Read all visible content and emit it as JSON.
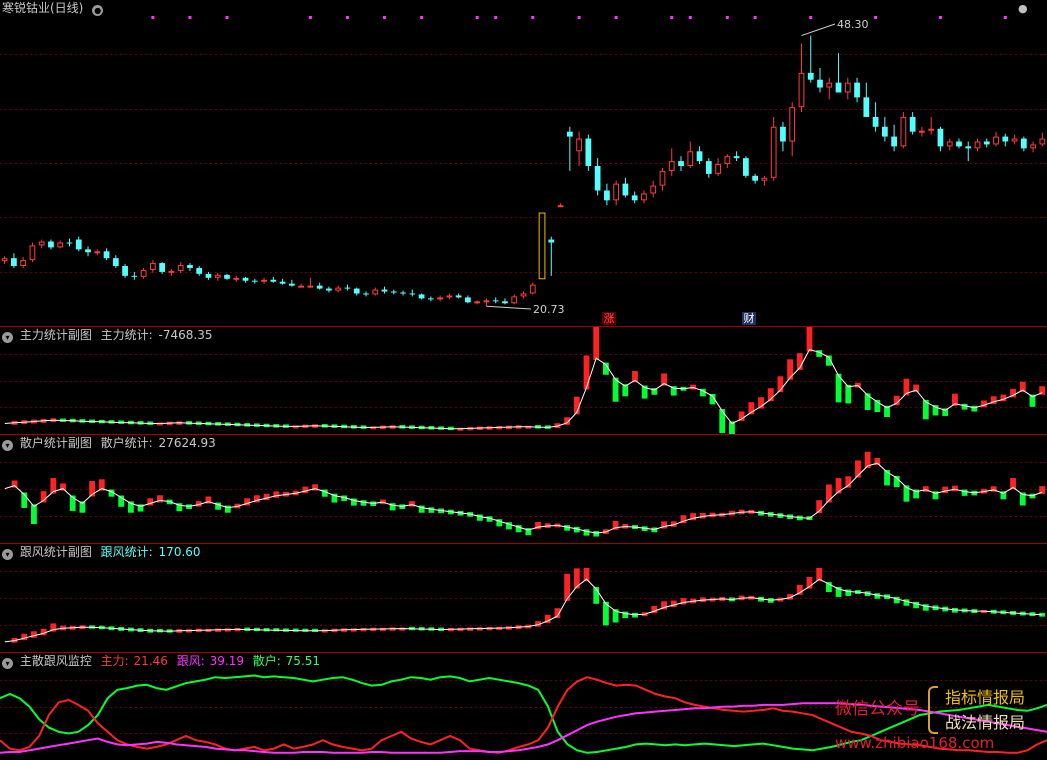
{
  "colors": {
    "up": "#ff3b3b",
    "down": "#54ffff",
    "grid": "#6a0000",
    "sep": "#a00000",
    "green": "#00ff33",
    "white": "#ffffff",
    "magenta": "#ff33ff",
    "red": "#ff2222",
    "mainforce_label": "#ff3b3b",
    "followwind_label": "#ff33ff",
    "retail_label": "#33ff66",
    "dot": "#ff33ff"
  },
  "main": {
    "title": "寒锐钴业(日线)",
    "high_label": "48.30",
    "low_label": "20.73",
    "marker_zhang": "涨",
    "marker_cai": "财",
    "price_range": [
      19.5,
      50.5
    ],
    "candles": [
      [
        25.3,
        25.8,
        25.0,
        25.6
      ],
      [
        25.6,
        26.1,
        24.6,
        24.8
      ],
      [
        24.8,
        25.7,
        24.6,
        25.4
      ],
      [
        25.4,
        27.2,
        25.2,
        26.9
      ],
      [
        26.9,
        27.5,
        26.6,
        27.3
      ],
      [
        27.3,
        27.5,
        26.5,
        26.7
      ],
      [
        26.7,
        27.4,
        26.6,
        27.2
      ],
      [
        27.2,
        27.6,
        26.8,
        27.1
      ],
      [
        27.5,
        27.8,
        26.3,
        26.5
      ],
      [
        26.5,
        26.8,
        25.8,
        26.2
      ],
      [
        26.2,
        26.5,
        25.9,
        26.3
      ],
      [
        26.3,
        26.6,
        25.4,
        25.6
      ],
      [
        25.6,
        25.9,
        24.6,
        24.8
      ],
      [
        24.8,
        25.0,
        23.6,
        23.8
      ],
      [
        23.8,
        24.2,
        23.4,
        23.7
      ],
      [
        23.7,
        24.6,
        23.5,
        24.4
      ],
      [
        24.4,
        25.4,
        24.1,
        25.1
      ],
      [
        25.1,
        25.2,
        24.0,
        24.2
      ],
      [
        24.2,
        24.5,
        23.8,
        24.3
      ],
      [
        24.3,
        25.2,
        24.1,
        24.9
      ],
      [
        24.9,
        25.1,
        24.3,
        24.6
      ],
      [
        24.6,
        24.8,
        23.8,
        24.0
      ],
      [
        24.0,
        24.2,
        23.4,
        23.6
      ],
      [
        23.6,
        24.1,
        23.3,
        23.9
      ],
      [
        23.9,
        24.0,
        23.4,
        23.5
      ],
      [
        23.5,
        23.8,
        23.2,
        23.6
      ],
      [
        23.6,
        23.7,
        23.1,
        23.3
      ],
      [
        23.3,
        23.5,
        23.0,
        23.2
      ],
      [
        23.2,
        23.6,
        23.0,
        23.4
      ],
      [
        23.4,
        23.7,
        23.1,
        23.2
      ],
      [
        23.2,
        23.5,
        22.9,
        23.0
      ],
      [
        23.0,
        23.4,
        22.7,
        22.8
      ],
      [
        22.8,
        23.0,
        22.6,
        22.8
      ],
      [
        22.8,
        23.6,
        22.7,
        22.8
      ],
      [
        22.8,
        23.1,
        22.4,
        22.5
      ],
      [
        22.5,
        22.7,
        22.1,
        22.3
      ],
      [
        22.3,
        22.8,
        22.1,
        22.6
      ],
      [
        22.6,
        22.9,
        22.3,
        22.5
      ],
      [
        22.5,
        22.6,
        21.8,
        22.0
      ],
      [
        22.0,
        22.2,
        21.7,
        21.9
      ],
      [
        21.9,
        22.6,
        21.8,
        22.4
      ],
      [
        22.4,
        22.7,
        22.0,
        22.2
      ],
      [
        22.2,
        22.4,
        21.9,
        22.1
      ],
      [
        22.1,
        22.3,
        21.8,
        22.0
      ],
      [
        22.0,
        22.4,
        21.7,
        21.9
      ],
      [
        21.9,
        22.0,
        21.4,
        21.5
      ],
      [
        21.5,
        21.7,
        21.2,
        21.4
      ],
      [
        21.4,
        21.8,
        21.2,
        21.6
      ],
      [
        21.6,
        22.0,
        21.4,
        21.8
      ],
      [
        21.8,
        22.0,
        21.5,
        21.6
      ],
      [
        21.6,
        21.8,
        21.0,
        21.1
      ],
      [
        21.1,
        21.3,
        20.9,
        21.2
      ],
      [
        21.2,
        21.5,
        20.7,
        21.3
      ],
      [
        21.3,
        21.6,
        21.0,
        21.2
      ],
      [
        21.2,
        21.5,
        20.9,
        21.0
      ],
      [
        21.0,
        21.9,
        20.9,
        21.7
      ],
      [
        21.7,
        22.2,
        21.5,
        22.0
      ],
      [
        22.0,
        23.1,
        21.9,
        22.9
      ],
      [
        23.5,
        23.5,
        23.5,
        23.5
      ],
      [
        27.5,
        27.8,
        23.8,
        27.2
      ],
      [
        31.0,
        31.2,
        30.8,
        31.0
      ],
      [
        38.5,
        39.0,
        34.5,
        38.0
      ],
      [
        36.5,
        38.5,
        35.0,
        37.8
      ],
      [
        37.8,
        38.2,
        34.5,
        35.0
      ],
      [
        35.0,
        35.8,
        32.0,
        32.5
      ],
      [
        32.5,
        33.2,
        31.0,
        31.5
      ],
      [
        31.5,
        33.5,
        31.0,
        33.2
      ],
      [
        33.2,
        33.8,
        31.8,
        32.0
      ],
      [
        32.0,
        32.4,
        31.2,
        31.5
      ],
      [
        31.5,
        32.5,
        31.2,
        32.2
      ],
      [
        32.2,
        33.5,
        31.8,
        33.0
      ],
      [
        33.0,
        34.8,
        32.5,
        34.5
      ],
      [
        34.5,
        36.8,
        34.0,
        35.5
      ],
      [
        35.5,
        36.0,
        34.5,
        35.0
      ],
      [
        35.0,
        37.5,
        34.8,
        36.5
      ],
      [
        36.5,
        37.0,
        35.2,
        35.5
      ],
      [
        35.5,
        35.8,
        33.8,
        34.2
      ],
      [
        34.2,
        35.8,
        34.0,
        35.2
      ],
      [
        35.2,
        36.2,
        34.8,
        36.0
      ],
      [
        36.0,
        36.5,
        35.5,
        35.8
      ],
      [
        35.8,
        36.0,
        33.8,
        34.0
      ],
      [
        34.0,
        34.2,
        33.2,
        33.5
      ],
      [
        33.5,
        34.0,
        33.0,
        33.8
      ],
      [
        33.8,
        40.0,
        33.5,
        39.0
      ],
      [
        39.0,
        39.5,
        36.5,
        37.5
      ],
      [
        37.5,
        41.5,
        36.0,
        41.0
      ],
      [
        41.0,
        47.5,
        40.5,
        44.5
      ],
      [
        44.5,
        48.3,
        43.5,
        43.8
      ],
      [
        43.8,
        45.0,
        42.5,
        43.0
      ],
      [
        43.0,
        44.0,
        41.8,
        43.5
      ],
      [
        43.5,
        46.5,
        43.0,
        42.5
      ],
      [
        42.5,
        44.0,
        41.8,
        43.5
      ],
      [
        43.5,
        44.0,
        41.5,
        42.0
      ],
      [
        42.0,
        43.5,
        41.0,
        40.0
      ],
      [
        40.0,
        41.5,
        38.5,
        39.0
      ],
      [
        39.0,
        40.0,
        37.5,
        38.0
      ],
      [
        38.0,
        39.2,
        36.5,
        37.0
      ],
      [
        37.0,
        40.5,
        36.8,
        40.0
      ],
      [
        40.0,
        40.5,
        38.2,
        38.5
      ],
      [
        38.5,
        39.0,
        38.0,
        38.6
      ],
      [
        38.6,
        40.0,
        38.2,
        38.8
      ],
      [
        38.8,
        39.0,
        36.5,
        37.0
      ],
      [
        37.0,
        37.8,
        36.6,
        37.5
      ],
      [
        37.5,
        37.8,
        36.8,
        37.0
      ],
      [
        37.0,
        37.5,
        35.5,
        36.8
      ],
      [
        36.8,
        37.8,
        36.5,
        37.5
      ],
      [
        37.5,
        37.8,
        36.9,
        37.2
      ],
      [
        37.2,
        38.5,
        37.0,
        38.0
      ],
      [
        38.0,
        38.3,
        37.0,
        37.5
      ],
      [
        37.5,
        38.2,
        37.2,
        37.8
      ],
      [
        37.8,
        38.0,
        36.5,
        36.8
      ],
      [
        36.8,
        37.5,
        36.4,
        37.2
      ],
      [
        37.2,
        38.4,
        37.0,
        37.8
      ]
    ],
    "dot_indices": [
      16,
      20,
      24,
      33,
      37,
      41,
      45,
      51,
      53,
      57,
      62,
      66,
      72,
      74,
      78,
      81,
      87,
      94,
      101,
      108,
      115
    ]
  },
  "zhuli": {
    "title": "主力统计副图",
    "stat_label": "主力统计:",
    "stat_value": "-7468.35",
    "line": [
      -2500,
      -2400,
      -2300,
      -2200,
      -2100,
      -2000,
      -2050,
      -2100,
      -2150,
      -2200,
      -2250,
      -2300,
      -2350,
      -2400,
      -2450,
      -2500,
      -2500,
      -2450,
      -2400,
      -2450,
      -2500,
      -2550,
      -2600,
      -2650,
      -2700,
      -2750,
      -2800,
      -2850,
      -2900,
      -2950,
      -2950,
      -2900,
      -2850,
      -2900,
      -2950,
      -3000,
      -3050,
      -3100,
      -3100,
      -3050,
      -3000,
      -3050,
      -3100,
      -3150,
      -3200,
      -3250,
      -3300,
      -3300,
      -3250,
      -3200,
      -3150,
      -3100,
      -3050,
      -3000,
      -3000,
      -3050,
      -3100,
      -2900,
      -2400,
      -800,
      3000,
      7500,
      6500,
      4200,
      3200,
      4100,
      3000,
      2600,
      3600,
      2900,
      2800,
      3000,
      2500,
      1700,
      -600,
      -2500,
      -1800,
      -800,
      100,
      1200,
      2600,
      4500,
      6000,
      8800,
      8400,
      7600,
      4800,
      3100,
      3300,
      1800,
      800,
      -100,
      600,
      2100,
      2600,
      800,
      0,
      -500,
      500,
      200,
      -100,
      300,
      800,
      1200,
      1800,
      2600,
      1600,
      2200
    ],
    "range": [
      -3500,
      9500
    ]
  },
  "sanhu": {
    "title": "散户统计副图",
    "stat_label": "散户统计:",
    "stat_value": "27624.93",
    "line": [
      34000,
      34500,
      33000,
      31000,
      32000,
      33500,
      34000,
      32500,
      31500,
      33000,
      34000,
      33500,
      32500,
      31500,
      31000,
      31500,
      32000,
      31800,
      31200,
      31000,
      31300,
      31800,
      31300,
      30800,
      31000,
      31500,
      32000,
      32400,
      32800,
      33000,
      33200,
      33600,
      34000,
      33500,
      32800,
      32500,
      32000,
      31700,
      31500,
      31700,
      31200,
      31000,
      31300,
      30800,
      30500,
      30300,
      30100,
      29900,
      29700,
      29300,
      29000,
      28500,
      28000,
      27500,
      27000,
      27500,
      27700,
      27800,
      27500,
      27200,
      26800,
      26500,
      26700,
      27400,
      27600,
      27500,
      27300,
      27100,
      27600,
      27900,
      28500,
      29000,
      29300,
      29500,
      29600,
      29800,
      30000,
      30100,
      29900,
      29700,
      29500,
      29300,
      29100,
      29000,
      30200,
      32000,
      33500,
      34500,
      36200,
      37800,
      38300,
      36800,
      35800,
      34200,
      33500,
      33800,
      33200,
      33600,
      33900,
      33500,
      33300,
      33500,
      33800,
      33200,
      34200,
      33000,
      32800,
      33400
    ],
    "range": [
      25500,
      40000
    ]
  },
  "genfeng": {
    "title": "跟风统计副图",
    "stat_label": "跟风统计:",
    "stat_value": "170.60",
    "line": [
      50,
      60,
      80,
      100,
      120,
      150,
      160,
      165,
      170,
      168,
      165,
      160,
      155,
      150,
      145,
      140,
      138,
      136,
      140,
      142,
      145,
      146,
      148,
      150,
      152,
      150,
      148,
      146,
      145,
      143,
      142,
      141,
      140,
      142,
      145,
      148,
      150,
      152,
      154,
      155,
      157,
      158,
      156,
      154,
      152,
      150,
      152,
      154,
      156,
      158,
      160,
      162,
      165,
      170,
      175,
      190,
      220,
      260,
      400,
      500,
      560,
      480,
      360,
      300,
      280,
      270,
      275,
      300,
      330,
      350,
      370,
      380,
      390,
      395,
      400,
      395,
      405,
      410,
      400,
      390,
      395,
      410,
      450,
      500,
      560,
      520,
      480,
      460,
      455,
      445,
      430,
      420,
      400,
      380,
      360,
      340,
      330,
      320,
      310,
      305,
      300,
      300,
      295,
      290,
      285,
      280,
      275,
      270
    ],
    "range": [
      0,
      700
    ]
  },
  "monitor": {
    "title": "主散跟风监控",
    "zhuli_label": "主力:",
    "zhuli_value": "21.46",
    "genfeng_label": "跟风:",
    "genfeng_value": "39.19",
    "sanhu_label": "散户:",
    "sanhu_value": "75.51",
    "red": [
      20,
      10,
      8,
      12,
      25,
      50,
      65,
      68,
      62,
      55,
      40,
      30,
      20,
      15,
      12,
      10,
      12,
      15,
      20,
      25,
      20,
      18,
      15,
      10,
      8,
      10,
      12,
      8,
      10,
      15,
      10,
      12,
      15,
      20,
      15,
      12,
      10,
      8,
      10,
      20,
      25,
      30,
      22,
      18,
      15,
      20,
      25,
      20,
      10,
      8,
      6,
      5,
      8,
      12,
      15,
      20,
      35,
      60,
      80,
      90,
      95,
      92,
      88,
      85,
      86,
      85,
      80,
      75,
      72,
      70,
      65,
      62,
      60,
      58,
      56,
      55,
      54,
      55,
      56,
      58,
      55,
      54,
      52,
      50,
      45,
      40,
      35,
      30,
      28,
      25,
      20,
      18,
      16,
      15,
      14,
      12,
      10,
      9,
      8,
      8,
      7,
      6,
      6,
      5,
      5,
      8,
      15,
      20
    ],
    "green": [
      70,
      75,
      70,
      60,
      45,
      35,
      30,
      28,
      30,
      38,
      50,
      70,
      80,
      82,
      85,
      86,
      82,
      80,
      84,
      88,
      90,
      92,
      95,
      94,
      95,
      96,
      97,
      95,
      96,
      95,
      94,
      92,
      90,
      92,
      94,
      95,
      92,
      88,
      85,
      86,
      90,
      92,
      95,
      94,
      92,
      95,
      96,
      94,
      90,
      92,
      94,
      92,
      90,
      88,
      85,
      80,
      60,
      30,
      15,
      8,
      5,
      6,
      8,
      10,
      12,
      15,
      16,
      15,
      14,
      15,
      14,
      15,
      16,
      15,
      14,
      13,
      14,
      15,
      16,
      14,
      12,
      10,
      9,
      8,
      10,
      12,
      15,
      18,
      20,
      25,
      30,
      35,
      40,
      45,
      50,
      52,
      54,
      55,
      56,
      58,
      60,
      62,
      60,
      58,
      56,
      55,
      58,
      62
    ],
    "magenta": [
      5,
      6,
      6,
      8,
      10,
      12,
      14,
      16,
      18,
      20,
      22,
      18,
      15,
      14,
      15,
      16,
      18,
      17,
      15,
      14,
      13,
      12,
      10,
      9,
      8,
      8,
      7,
      6,
      5,
      5,
      5,
      6,
      6,
      6,
      5,
      5,
      5,
      5,
      6,
      6,
      5,
      5,
      5,
      5,
      5,
      5,
      6,
      7,
      7,
      7,
      6,
      6,
      7,
      8,
      10,
      12,
      15,
      20,
      26,
      32,
      38,
      42,
      45,
      48,
      50,
      52,
      53,
      54,
      55,
      56,
      57,
      58,
      58,
      59,
      60,
      60,
      61,
      61,
      62,
      62,
      62,
      63,
      64,
      64,
      64,
      64,
      64,
      63,
      62,
      61,
      60,
      59,
      58,
      57,
      56,
      54,
      52,
      50,
      48,
      46,
      44,
      42,
      40,
      38,
      36,
      34,
      32,
      30
    ],
    "range": [
      0,
      100
    ]
  },
  "watermark": {
    "weixin": "微信公众号",
    "zhibiao": "指标情报局",
    "zhanfa": "战法情报局",
    "site": "www.zhibiao168.com"
  }
}
